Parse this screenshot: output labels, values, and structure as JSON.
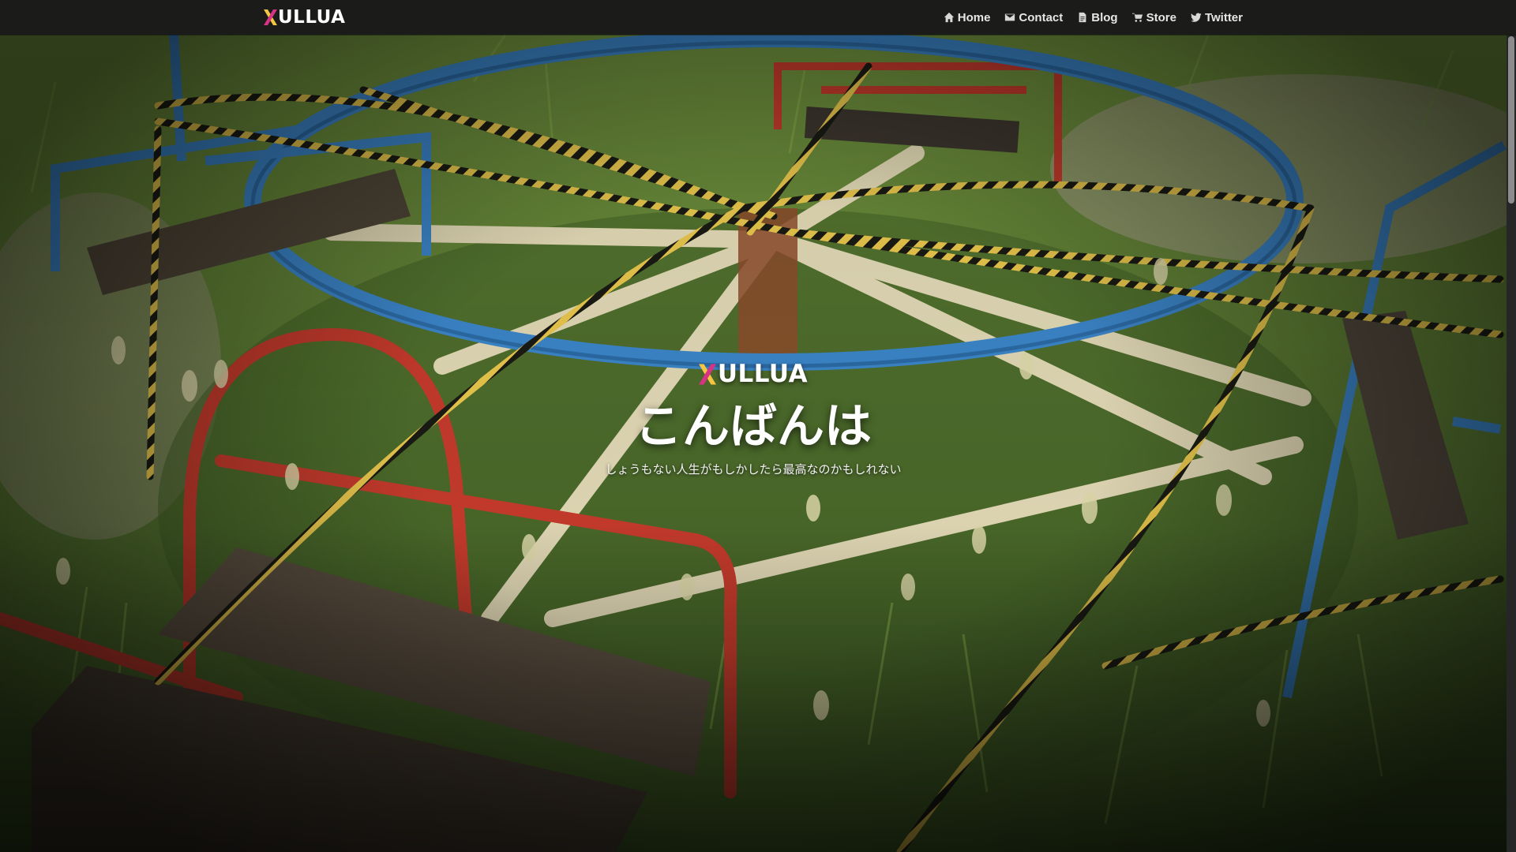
{
  "navbar": {
    "brand": "XULLUA",
    "links": [
      {
        "label": "Home",
        "icon": "home-icon"
      },
      {
        "label": "Contact",
        "icon": "mail-icon"
      },
      {
        "label": "Blog",
        "icon": "document-icon"
      },
      {
        "label": "Store",
        "icon": "cart-icon"
      },
      {
        "label": "Twitter",
        "icon": "twitter-icon"
      }
    ]
  },
  "hero": {
    "logo": "XULLUA",
    "title": "こんばんは",
    "subtitle": "しょうもない人生がもしかしたら最高なのかもしれない",
    "background": "merry-go-round-photo"
  },
  "colors": {
    "navbar_bg": "#1b1c19",
    "logo_x_top": "#f4c542",
    "logo_x_bottom": "#d63384",
    "text": "#ffffff"
  }
}
